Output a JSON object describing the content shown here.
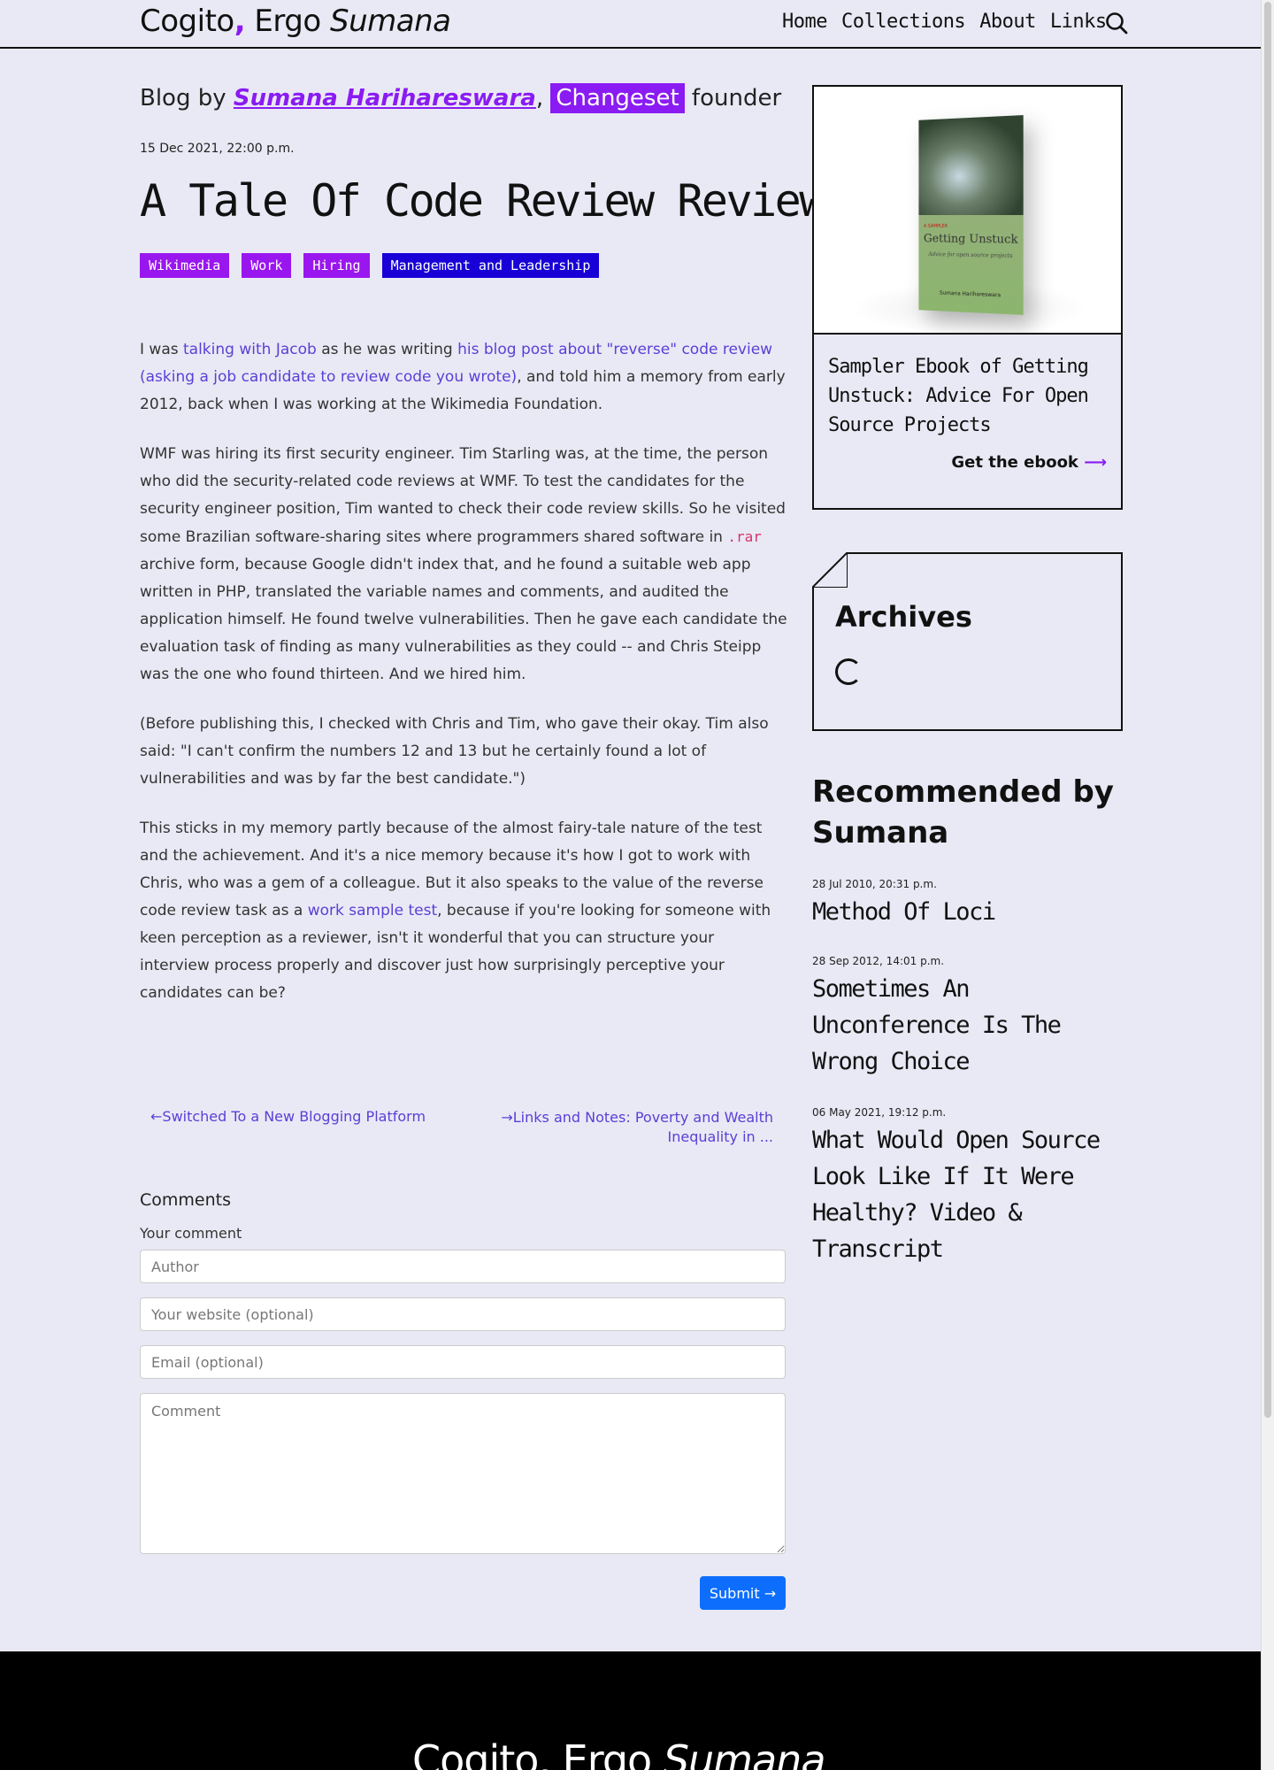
{
  "header": {
    "brand_part1": "Cogito",
    "brand_comma": ",",
    "brand_part2": " Ergo ",
    "brand_part3": "Sumana",
    "nav": [
      "Home",
      "Collections",
      "About",
      "Links"
    ]
  },
  "blog_by": {
    "prefix": "Blog by ",
    "author": "Sumana Harihareswara",
    "sep": ", ",
    "company": "Changeset",
    "suffix": " founder"
  },
  "post": {
    "date": "15 Dec 2021, 22:00 p.m.",
    "title": "A Tale Of Code Review Review",
    "tags": [
      "Wikimedia",
      "Work",
      "Hiring",
      "Management and Leadership"
    ],
    "p1": {
      "t1": "I was ",
      "link1": "talking with Jacob",
      "t2": " as he was writing ",
      "link2": "his blog post about \"reverse\" code review (asking a job candidate to review code you wrote)",
      "t3": ", and told him a memory from early 2012, back when I was working at the Wikimedia Foundation."
    },
    "p2": {
      "t1": "WMF was hiring its first security engineer. Tim Starling was, at the time, the person who did the security-related code reviews at WMF. To test the candidates for the security engineer position, Tim wanted to check their code review skills. So he visited some Brazilian software-sharing sites where programmers shared software in ",
      "code": ".rar",
      "t2": " archive form, because Google didn't index that, and he found a suitable web app written in PHP, translated the variable names and comments, and audited the application himself. He found twelve vulnerabilities. Then he gave each candidate the evaluation task of finding as many vulnerabilities as they could -- and Chris Steipp was the one who found thirteen. And we hired him."
    },
    "p3": "(Before publishing this, I checked with Chris and Tim, who gave their okay. Tim also said: \"I can't confirm the numbers 12 and 13 but he certainly found a lot of vulnerabilities and was by far the best candidate.\")",
    "p4": {
      "t1": "This sticks in my memory partly because of the almost fairy-tale nature of the test and the achievement. And it's a nice memory because it's how I got to work with Chris, who was a gem of a colleague. But it also speaks to the value of the reverse code review task as a ",
      "link": "work sample test",
      "t2": ", because if you're looking for someone with keen perception as a reviewer, isn't it wonderful that you can structure your interview process properly and discover just how surprisingly perceptive your candidates can be?"
    }
  },
  "prev_next": {
    "prev": "Switched To a New Blogging Platform",
    "next": "Links and Notes: Poverty and Wealth Inequality in ..."
  },
  "comments": {
    "heading": "Comments",
    "subheading": "Your comment",
    "author_placeholder": "Author",
    "website_placeholder": "Your website (optional)",
    "email_placeholder": "Email (optional)",
    "comment_placeholder": "Comment",
    "submit": "Submit"
  },
  "sidebar": {
    "ebook": {
      "cover_tag": "A SAMPLER",
      "cover_title": "Getting Unstuck",
      "cover_subtitle": "Advice for open source projects",
      "cover_author": "Sumana Harihareswara",
      "title": "Sampler Ebook of Getting Unstuck: Advice For Open Source Projects",
      "link": "Get the ebook"
    },
    "archives": {
      "title": "Archives"
    },
    "recommended": {
      "title": "Recommended by Sumana",
      "items": [
        {
          "date": "28 Jul 2010, 20:31 p.m.",
          "title": "Method Of Loci"
        },
        {
          "date": "28 Sep 2012, 14:01 p.m.",
          "title": "Sometimes An Unconference Is The Wrong Choice"
        },
        {
          "date": "06 May 2021, 19:12 p.m.",
          "title": "What Would Open Source Look Like If It Were Healthy? Video & Transcript"
        }
      ]
    }
  },
  "footer": {
    "brand_part1": "Cogito, Ergo ",
    "brand_part2": "Sumana"
  },
  "colors": {
    "accent": "#8a1bf2",
    "tag_dark": "#1800d6",
    "background": "#e9e9f5",
    "button": "#0d6efd"
  }
}
